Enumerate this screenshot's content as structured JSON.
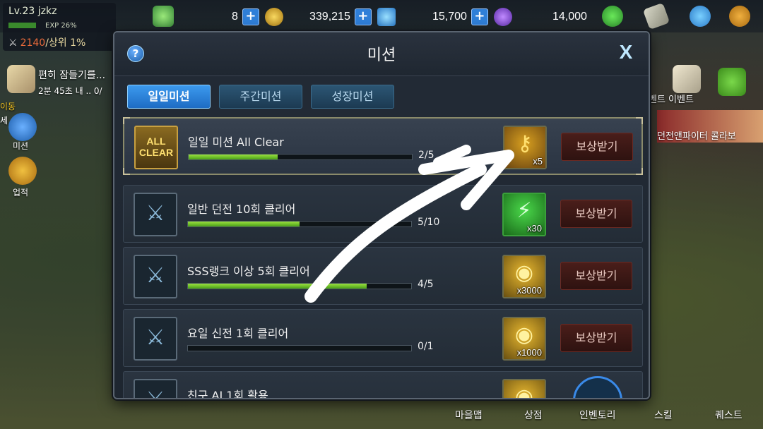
{
  "player": {
    "level": "Lv.23",
    "name": "jzkz",
    "exp": 0.26,
    "exp_text": "EXP 26%",
    "power": "2140",
    "rank": "/상위 1%"
  },
  "resources": [
    {
      "name": "stamina",
      "value": "8",
      "icon": "stamina-bolt-icon",
      "color": "#7ad85a"
    },
    {
      "name": "gold",
      "value": "339,215",
      "icon": "gold-coin-icon",
      "color": "#e8b830"
    },
    {
      "name": "gem",
      "value": "15,700",
      "icon": "diamond-icon",
      "color": "#5ab8f0"
    },
    {
      "name": "crystal",
      "value": "14,000",
      "icon": "purple-crystal-icon",
      "color": "#8a4ad8"
    }
  ],
  "side_menu": {
    "notice": "편히 잠들기를...",
    "timer": "2분 45초 내 .. 0/",
    "move": "이동",
    "mission": "미션",
    "achievement": "업적",
    "hint": "세"
  },
  "right_panel": {
    "event": "벤트  이벤트",
    "banner": "던전앤파이터 콜라보"
  },
  "bottom_nav": [
    "마을맵",
    "상점",
    "인벤토리",
    "스킬",
    "퀘스트"
  ],
  "modal": {
    "title": "미션",
    "help": "?",
    "close": "X",
    "tabs": [
      {
        "label": "일일미션",
        "active": true
      },
      {
        "label": "주간미션",
        "active": false
      },
      {
        "label": "성장미션",
        "active": false
      }
    ],
    "claim_label": "보상받기",
    "missions": [
      {
        "title": "일일 미션 All Clear",
        "progress_text": "2/5",
        "progress": 0.4,
        "icon": "all-clear-icon",
        "icon_text": "ALL CLEAR",
        "reward_icon": "golden-key-icon",
        "reward_count": "x5",
        "highlight": true
      },
      {
        "title": "일반 던전 10회 클리어",
        "progress_text": "5/10",
        "progress": 0.5,
        "icon": "crossed-swords-icon",
        "reward_icon": "stamina-potion-icon",
        "reward_count": "x30",
        "highlight": false
      },
      {
        "title": "SSS랭크 이상 5회 클리어",
        "progress_text": "4/5",
        "progress": 0.8,
        "icon": "crossed-swords-icon",
        "reward_icon": "gold-coins-icon",
        "reward_count": "x3000",
        "highlight": false
      },
      {
        "title": "요일 신전 1회 클리어",
        "progress_text": "0/1",
        "progress": 0.0,
        "icon": "crossed-swords-icon",
        "reward_icon": "gold-coins-icon",
        "reward_count": "x1000",
        "highlight": false
      },
      {
        "title": "친구 AI 1회 활용",
        "progress_text": "",
        "progress": 0.0,
        "icon": "crossed-swords-icon",
        "reward_icon": "gold-coins-icon",
        "reward_count": "",
        "highlight": false
      }
    ]
  }
}
